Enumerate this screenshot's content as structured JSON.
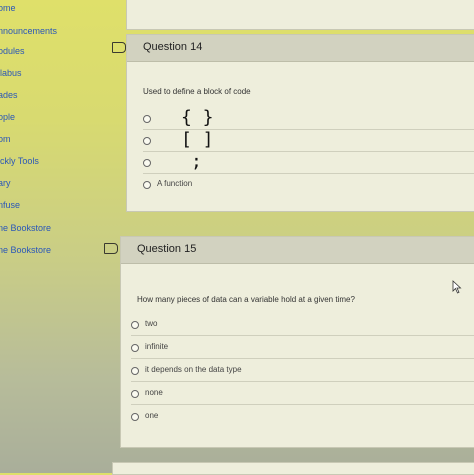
{
  "sidebar": {
    "items": [
      {
        "label": "ome"
      },
      {
        "label": "nnouncements"
      },
      {
        "label": "odules"
      },
      {
        "label": "llabus"
      },
      {
        "label": "ades"
      },
      {
        "label": "ople"
      },
      {
        "label": "om"
      },
      {
        "label": "ickly Tools"
      },
      {
        "label": "ary"
      },
      {
        "label": "nfuse"
      },
      {
        "label": "ne Bookstore"
      },
      {
        "label": "ne Bookstore"
      }
    ]
  },
  "question14": {
    "title": "Question 14",
    "prompt": "Used to define a block of code",
    "options": [
      {
        "label": "{ }"
      },
      {
        "label": "[ ]"
      },
      {
        "label": ";"
      },
      {
        "label": "A function"
      }
    ]
  },
  "question15": {
    "title": "Question 15",
    "prompt": "How many pieces of data can a variable hold at a given time?",
    "options": [
      {
        "label": "two"
      },
      {
        "label": "infinite"
      },
      {
        "label": "it depends on the data type"
      },
      {
        "label": "none"
      },
      {
        "label": "one"
      }
    ]
  }
}
